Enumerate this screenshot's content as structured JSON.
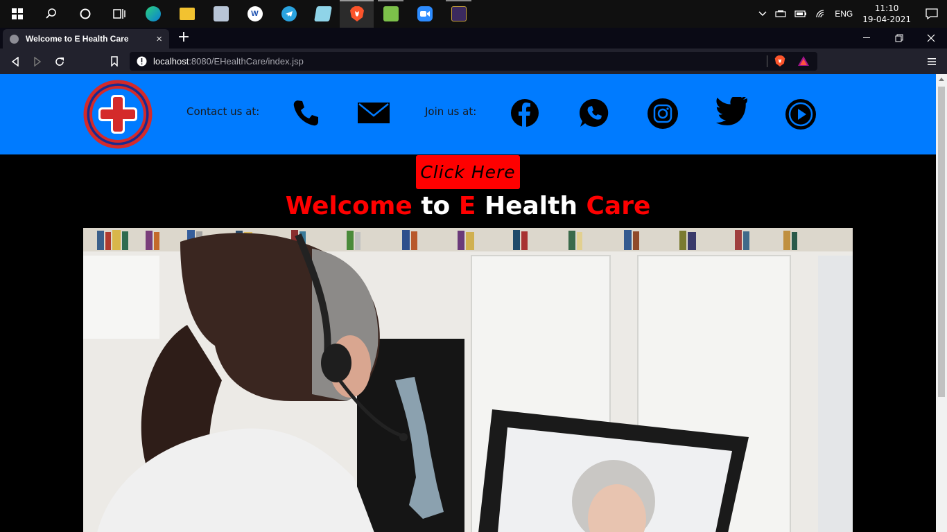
{
  "taskbar": {
    "apps": [
      {
        "name": "start-icon"
      },
      {
        "name": "search-icon"
      },
      {
        "name": "cortana-icon"
      },
      {
        "name": "task-view-icon"
      },
      {
        "name": "edge-icon"
      },
      {
        "name": "file-explorer-icon"
      },
      {
        "name": "monitor-app-icon"
      },
      {
        "name": "wps-icon"
      },
      {
        "name": "telegram-icon"
      },
      {
        "name": "notes-app-icon"
      },
      {
        "name": "brave-icon"
      },
      {
        "name": "notepad-icon"
      },
      {
        "name": "zoom-icon"
      },
      {
        "name": "game-icon"
      }
    ],
    "tray": {
      "language": "ENG",
      "time": "11:10",
      "date": "19-04-2021"
    }
  },
  "browser": {
    "tab_title": "Welcome to E Health Care",
    "tab_close": "×",
    "new_tab": "+",
    "url_host": "localhost",
    "url_path": ":8080/EHealthCare/index.jsp"
  },
  "header": {
    "contact_label": "Contact us at:",
    "join_label": "Join us at:"
  },
  "cta": {
    "label": "Click Here"
  },
  "welcome": {
    "part1": "Welcome",
    "part2": "to",
    "part3": "E",
    "part4": "Health",
    "part5": "Care"
  },
  "colors": {
    "header_bg": "#007bff",
    "accent_red": "#ff0000",
    "page_bg": "#000000"
  }
}
